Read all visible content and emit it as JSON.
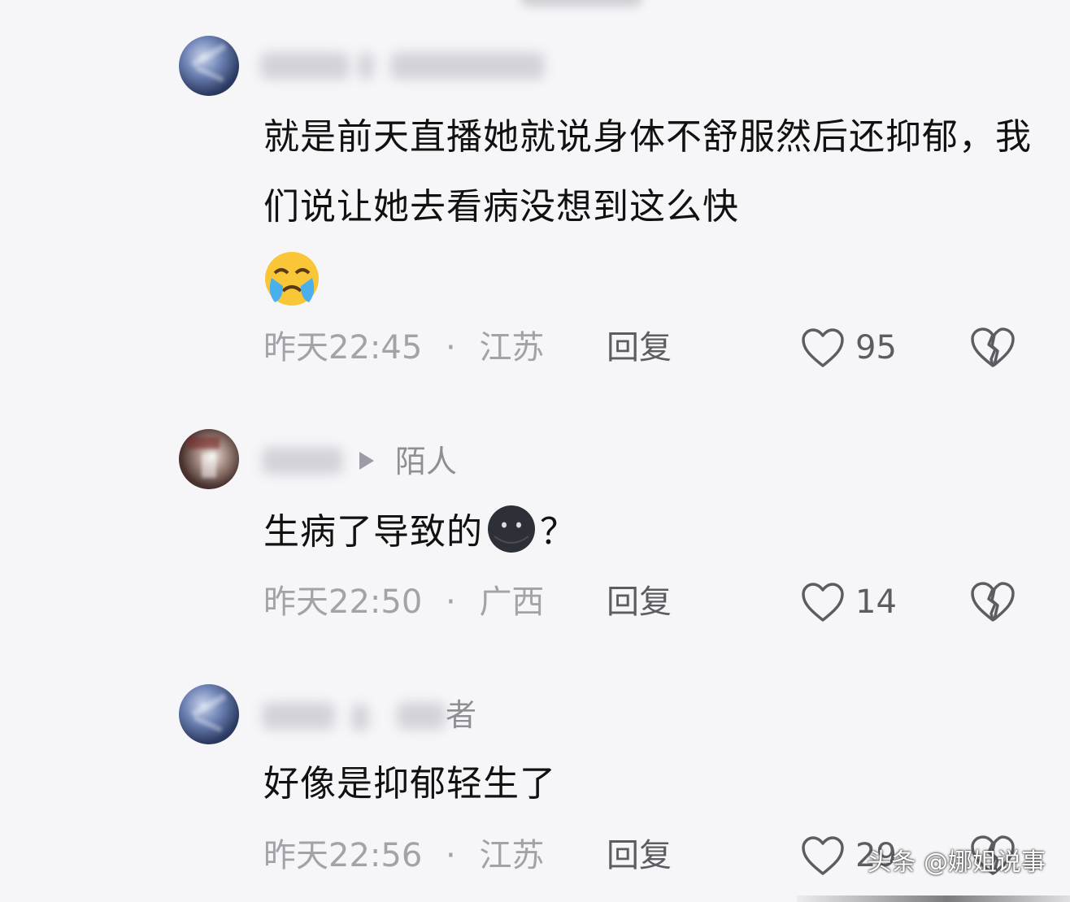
{
  "comments": [
    {
      "tag": "",
      "text": "就是前天直播她就说身体不舒服然后还抑郁，我们说让她去看病没想到这么快",
      "emoji": "loudly-crying-face",
      "time": "昨天22:45",
      "location": "江苏",
      "reply_label": "回复",
      "likes": "95"
    },
    {
      "tag": "陌人",
      "text": "生病了导致的",
      "text_suffix": "？",
      "emoji": "dark-blob-face",
      "time": "昨天22:50",
      "location": "广西",
      "reply_label": "回复",
      "likes": "14"
    },
    {
      "tag": "者",
      "text": "好像是抑郁轻生了",
      "time": "昨天22:56",
      "location": "江苏",
      "reply_label": "回复",
      "likes": "29"
    }
  ],
  "separator": "·",
  "watermark": "头条 @娜姐说事",
  "colors": {
    "background": "#f6f6f9",
    "meta": "#a2a2a8",
    "text": "#111111"
  }
}
